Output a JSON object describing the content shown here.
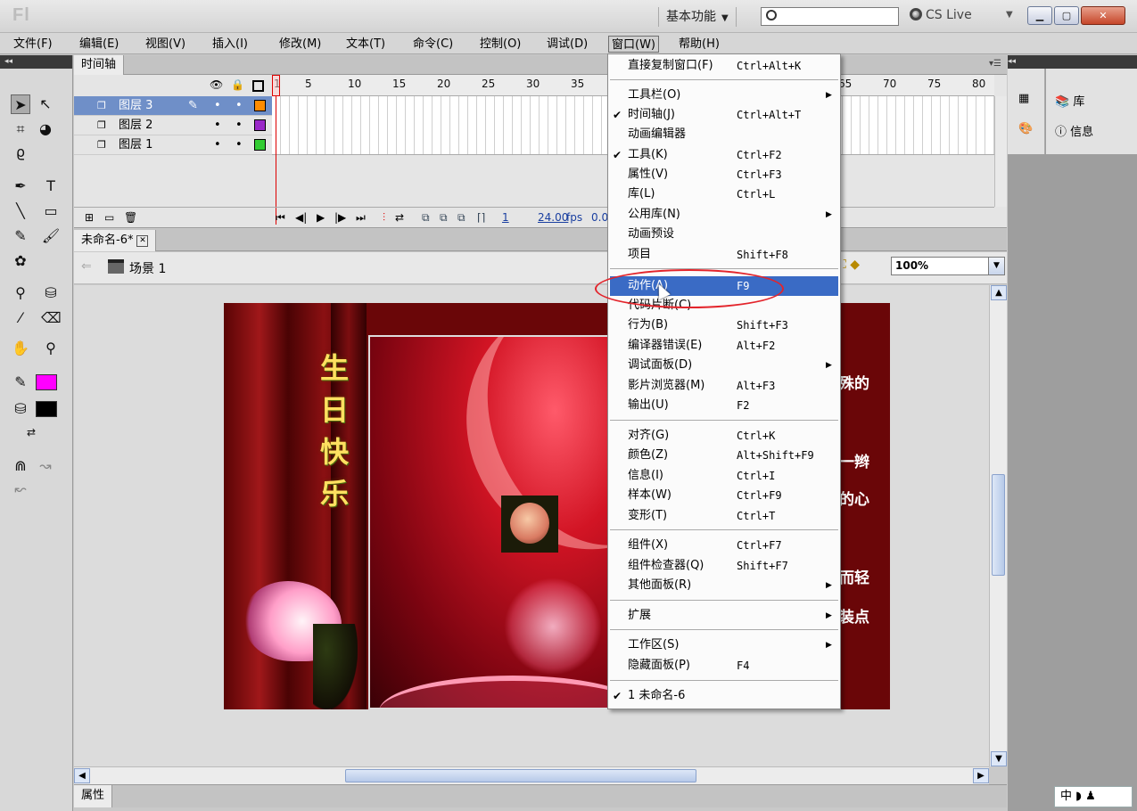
{
  "app": {
    "logo": "Fl",
    "workspace": "基本功能",
    "cs_live": "CS Live"
  },
  "menubar": [
    "文件(F)",
    "编辑(E)",
    "视图(V)",
    "插入(I)",
    "修改(M)",
    "文本(T)",
    "命令(C)",
    "控制(O)",
    "调试(D)",
    "窗口(W)",
    "帮助(H)"
  ],
  "timeline": {
    "tab": "时间轴",
    "layers": [
      "图层 3",
      "图层 2",
      "图层 1"
    ],
    "layer_colors": [
      "#ff8c00",
      "#9a28c8",
      "#33cc33"
    ],
    "ruler_labels": [
      "1",
      "5",
      "10",
      "15",
      "20",
      "25",
      "30",
      "35",
      "40",
      "45",
      "50",
      "55",
      "60",
      "65",
      "70",
      "75",
      "80"
    ],
    "current_frame": "1",
    "fps": "24.00",
    "fps_unit": "fps",
    "elapsed": "0.0"
  },
  "document": {
    "tab": "未命名-6*",
    "scene": "场景 1",
    "zoom": "100%"
  },
  "stage": {
    "title_chars": [
      "生",
      "日",
      "快",
      "乐"
    ],
    "poem_fragments": [
      "殊的",
      "一辫",
      "的心",
      "而轻",
      "装点"
    ]
  },
  "properties_tab": "属性",
  "right_panel": {
    "library": "库",
    "info": "信息"
  },
  "ime": "中",
  "window_menu": {
    "items": [
      {
        "label": "直接复制窗口(F)",
        "shortcut": "Ctrl+Alt+K",
        "check": false,
        "submenu": false
      },
      {
        "label": "工具栏(O)",
        "shortcut": "",
        "check": false,
        "submenu": true
      },
      {
        "label": "时间轴(J)",
        "shortcut": "Ctrl+Alt+T",
        "check": true,
        "submenu": false
      },
      {
        "label": "动画编辑器",
        "shortcut": "",
        "check": false,
        "submenu": false
      },
      {
        "label": "工具(K)",
        "shortcut": "Ctrl+F2",
        "check": true,
        "submenu": false
      },
      {
        "label": "属性(V)",
        "shortcut": "Ctrl+F3",
        "check": false,
        "submenu": false
      },
      {
        "label": "库(L)",
        "shortcut": "Ctrl+L",
        "check": false,
        "submenu": false
      },
      {
        "label": "公用库(N)",
        "shortcut": "",
        "check": false,
        "submenu": true
      },
      {
        "label": "动画预设",
        "shortcut": "",
        "check": false,
        "submenu": false
      },
      {
        "label": "项目",
        "shortcut": "Shift+F8",
        "check": false,
        "submenu": false
      },
      {
        "label": "动作(A)",
        "shortcut": "F9",
        "check": false,
        "submenu": false,
        "highlighted": true
      },
      {
        "label": "代码片断(C)",
        "shortcut": "",
        "check": false,
        "submenu": false
      },
      {
        "label": "行为(B)",
        "shortcut": "Shift+F3",
        "check": false,
        "submenu": false
      },
      {
        "label": "编译器错误(E)",
        "shortcut": "Alt+F2",
        "check": false,
        "submenu": false
      },
      {
        "label": "调试面板(D)",
        "shortcut": "",
        "check": false,
        "submenu": true
      },
      {
        "label": "影片浏览器(M)",
        "shortcut": "Alt+F3",
        "check": false,
        "submenu": false
      },
      {
        "label": "输出(U)",
        "shortcut": "F2",
        "check": false,
        "submenu": false
      },
      {
        "label": "对齐(G)",
        "shortcut": "Ctrl+K",
        "check": false,
        "submenu": false
      },
      {
        "label": "颜色(Z)",
        "shortcut": "Alt+Shift+F9",
        "check": false,
        "submenu": false
      },
      {
        "label": "信息(I)",
        "shortcut": "Ctrl+I",
        "check": false,
        "submenu": false
      },
      {
        "label": "样本(W)",
        "shortcut": "Ctrl+F9",
        "check": false,
        "submenu": false
      },
      {
        "label": "变形(T)",
        "shortcut": "Ctrl+T",
        "check": false,
        "submenu": false
      },
      {
        "label": "组件(X)",
        "shortcut": "Ctrl+F7",
        "check": false,
        "submenu": false
      },
      {
        "label": "组件检查器(Q)",
        "shortcut": "Shift+F7",
        "check": false,
        "submenu": false
      },
      {
        "label": "其他面板(R)",
        "shortcut": "",
        "check": false,
        "submenu": true
      },
      {
        "label": "扩展",
        "shortcut": "",
        "check": false,
        "submenu": true
      },
      {
        "label": "工作区(S)",
        "shortcut": "",
        "check": false,
        "submenu": true
      },
      {
        "label": "隐藏面板(P)",
        "shortcut": "F4",
        "check": false,
        "submenu": false
      },
      {
        "label": "1 未命名-6",
        "shortcut": "",
        "check": true,
        "submenu": false
      }
    ]
  },
  "colors": {
    "stroke_color": "#ff00ff",
    "fill_color": "#000000",
    "menu_highlight": "#3a6bc5",
    "annotation_ellipse": "#e3242b"
  }
}
